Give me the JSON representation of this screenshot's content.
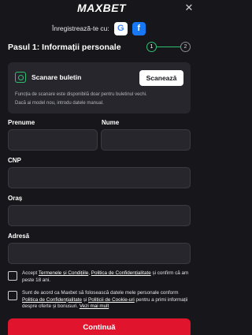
{
  "header": {
    "logo_text": "MAXBET",
    "close_glyph": "✕"
  },
  "register": {
    "label": "Înregistrează-te cu:",
    "providers": [
      {
        "name": "google-icon",
        "glyph": "G"
      },
      {
        "name": "facebook-icon",
        "glyph": "f"
      }
    ]
  },
  "step": {
    "title": "Pasul 1: Informații personale",
    "current": "1",
    "next": "2"
  },
  "scan": {
    "title": "Scanare buletin",
    "button": "Scanează",
    "desc_line1": "Funcția de scanare este disponibilă doar pentru buletinul vechi.",
    "desc_line2": "Dacă ai model nou, introdu datele manual."
  },
  "fields": {
    "first_name": {
      "label": "Prenume",
      "value": ""
    },
    "last_name": {
      "label": "Nume",
      "value": ""
    },
    "cnp": {
      "label": "CNP",
      "value": ""
    },
    "city": {
      "label": "Oraș",
      "value": ""
    },
    "address": {
      "label": "Adresă",
      "value": ""
    }
  },
  "consent_terms": {
    "prefix": "Accept ",
    "link1": "Termenele și Condițiile",
    "mid": ", ",
    "link2": "Politica de Confidențialitate",
    "suffix": " și confirm că am peste 18 ani."
  },
  "consent_marketing": {
    "prefix": "Sunt de acord ca Maxbet să folosească datele mele personale conform ",
    "link1": "Politica de Confidențialitate",
    "mid": " și ",
    "link2": "Politicii de Cookie-uri",
    "suffix": " pentru a primi informații despre oferte și bonusuri. ",
    "link3": "Vezi mai mult"
  },
  "continue_label": "Continuă",
  "colors": {
    "accent_green": "#2fbf71",
    "primary_red": "#e0142c",
    "background": "#17171b",
    "surface": "#26262c"
  }
}
